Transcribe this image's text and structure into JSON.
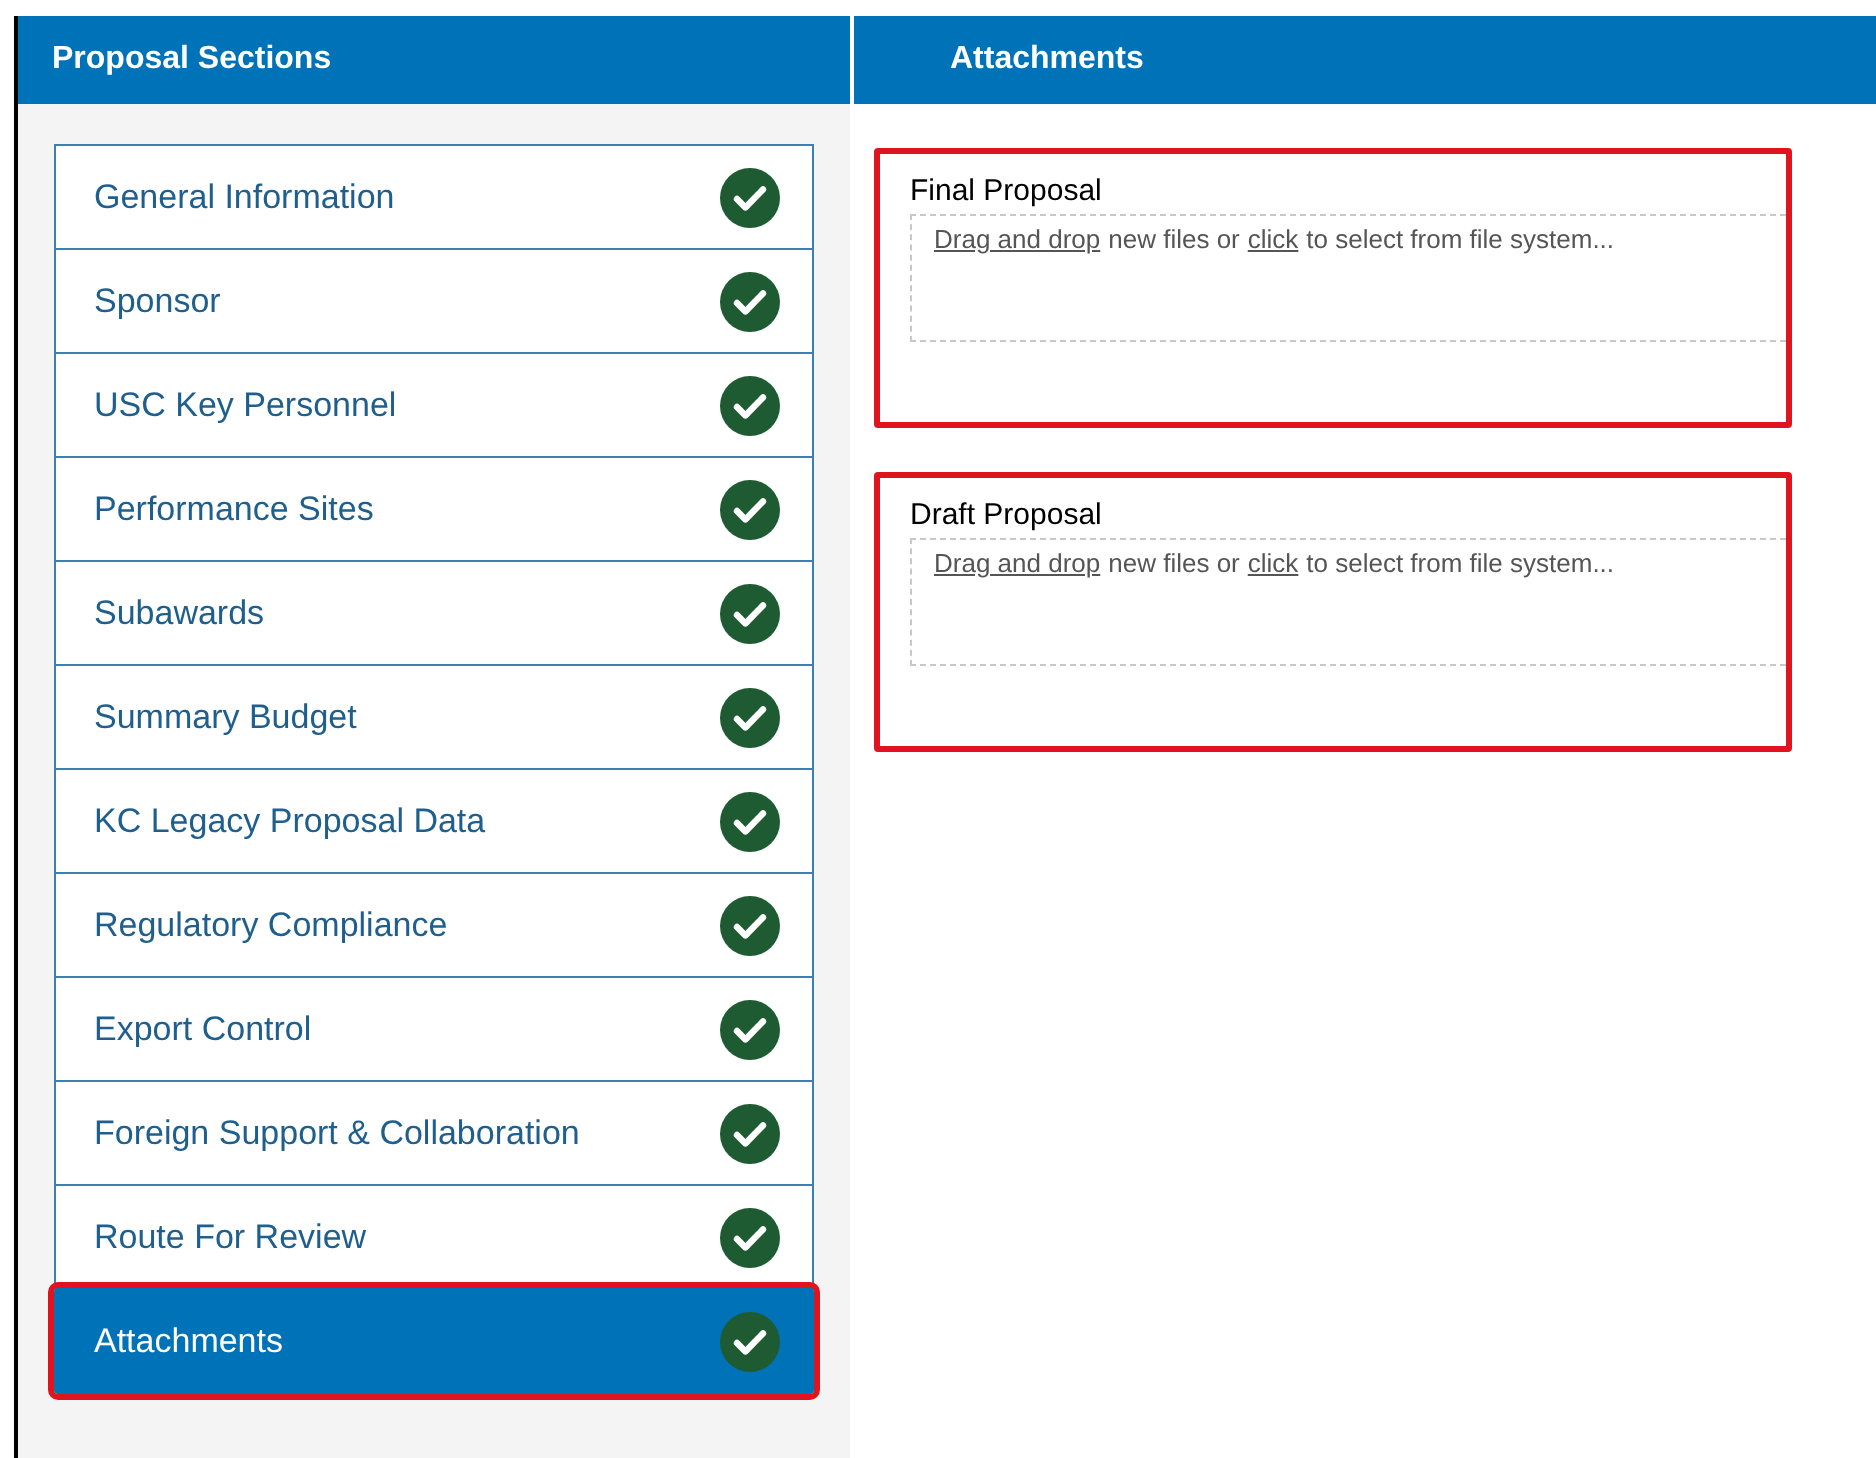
{
  "sidebar": {
    "title": "Proposal Sections",
    "items": [
      {
        "label": "General Information",
        "completed": true,
        "selected": false,
        "highlighted": false
      },
      {
        "label": "Sponsor",
        "completed": true,
        "selected": false,
        "highlighted": false
      },
      {
        "label": "USC Key Personnel",
        "completed": true,
        "selected": false,
        "highlighted": false
      },
      {
        "label": "Performance Sites",
        "completed": true,
        "selected": false,
        "highlighted": false
      },
      {
        "label": "Subawards",
        "completed": true,
        "selected": false,
        "highlighted": false
      },
      {
        "label": "Summary Budget",
        "completed": true,
        "selected": false,
        "highlighted": false
      },
      {
        "label": "KC Legacy Proposal Data",
        "completed": true,
        "selected": false,
        "highlighted": false
      },
      {
        "label": "Regulatory Compliance",
        "completed": true,
        "selected": false,
        "highlighted": false
      },
      {
        "label": "Export Control",
        "completed": true,
        "selected": false,
        "highlighted": false
      },
      {
        "label": "Foreign Support & Collaboration",
        "completed": true,
        "selected": false,
        "highlighted": false
      },
      {
        "label": "Route For Review",
        "completed": true,
        "selected": false,
        "highlighted": false
      },
      {
        "label": "Attachments",
        "completed": true,
        "selected": true,
        "highlighted": true
      }
    ]
  },
  "main": {
    "title": "Attachments",
    "sections": [
      {
        "label": "Final Proposal",
        "highlighted": true,
        "hint": [
          {
            "kind": "link",
            "text": "Drag and drop"
          },
          {
            "kind": "text",
            "text": "new files or"
          },
          {
            "kind": "link",
            "text": "click"
          },
          {
            "kind": "text",
            "text": "to select from file system..."
          }
        ]
      },
      {
        "label": "Draft Proposal",
        "highlighted": true,
        "hint": [
          {
            "kind": "link",
            "text": "Drag and drop"
          },
          {
            "kind": "text",
            "text": "new files or"
          },
          {
            "kind": "link",
            "text": "click"
          },
          {
            "kind": "text",
            "text": "to select from file system..."
          }
        ]
      }
    ]
  }
}
